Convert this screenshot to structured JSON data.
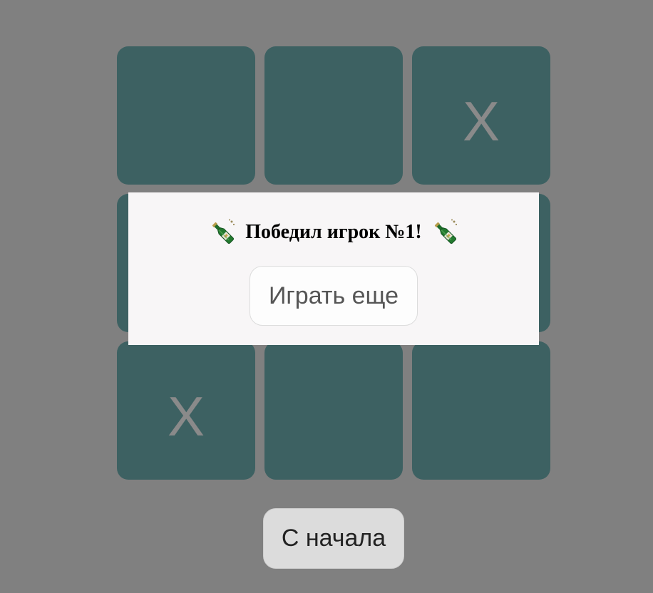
{
  "board": {
    "cells": [
      "",
      "",
      "X",
      "",
      "",
      "",
      "X",
      "",
      ""
    ]
  },
  "modal": {
    "title": "Победил игрок №1!",
    "left_icon": "champagne-bottle-icon",
    "right_icon": "champagne-bottle-icon",
    "play_again_label": "Играть еще"
  },
  "controls": {
    "restart_label": "С начала"
  },
  "colors": {
    "background": "#808080",
    "cell": "#3d6162",
    "mark": "#8a8a8a",
    "modal": "#f8f6f7"
  }
}
